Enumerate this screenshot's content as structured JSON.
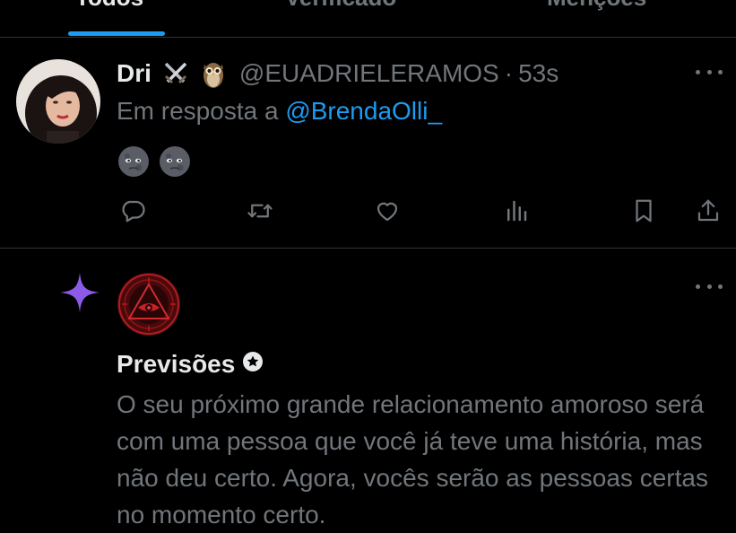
{
  "tabs": [
    {
      "label": "Todos"
    },
    {
      "label": "Verificado"
    },
    {
      "label": "Menções"
    }
  ],
  "tweet": {
    "display_name": "Dri",
    "name_emoji": [
      "crossed-swords",
      "owl"
    ],
    "handle": "@EUADRIELERAMOS",
    "separator": "·",
    "time": "53s",
    "reply_prefix": "Em resposta a",
    "reply_mention": "@BrendaOlli_",
    "body_emoji": [
      "new-moon-face",
      "new-moon-face"
    ],
    "actions": [
      "reply",
      "retweet",
      "like",
      "views",
      "bookmark",
      "share"
    ]
  },
  "card": {
    "name": "Previsões",
    "text": "O seu próximo grande relacionamento amoroso será com uma pessoa que você já teve uma história, mas não deu certo. Agora, vocês serão as pessoas certas no momento certo.",
    "accent_color": "#8c5ae8"
  },
  "colors": {
    "background": "#000000",
    "primary_text": "#e7e9ea",
    "secondary_text": "#71767b",
    "link": "#1d9bf0",
    "divider": "#2f3336",
    "sparkle": "#8c5ae8"
  }
}
